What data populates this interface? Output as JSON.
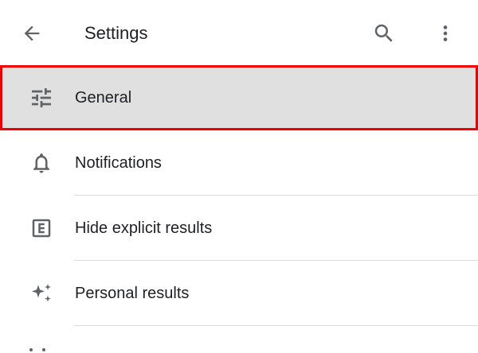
{
  "app_bar": {
    "title": "Settings",
    "back_icon": "arrow-back-icon",
    "search_icon": "search-icon",
    "more_icon": "more-vert-icon"
  },
  "settings": {
    "items": [
      {
        "label": "General",
        "icon": "tune-icon",
        "selected": true
      },
      {
        "label": "Notifications",
        "icon": "bell-icon",
        "selected": false
      },
      {
        "label": "Hide explicit results",
        "icon": "explicit-icon",
        "selected": false
      },
      {
        "label": "Personal results",
        "icon": "sparkle-icon",
        "selected": false
      }
    ]
  },
  "colors": {
    "icon": "#5f6368",
    "text": "#202124",
    "divider": "#dadce0",
    "selected_bg": "#e0e0e0",
    "highlight_border": "#f00000"
  }
}
